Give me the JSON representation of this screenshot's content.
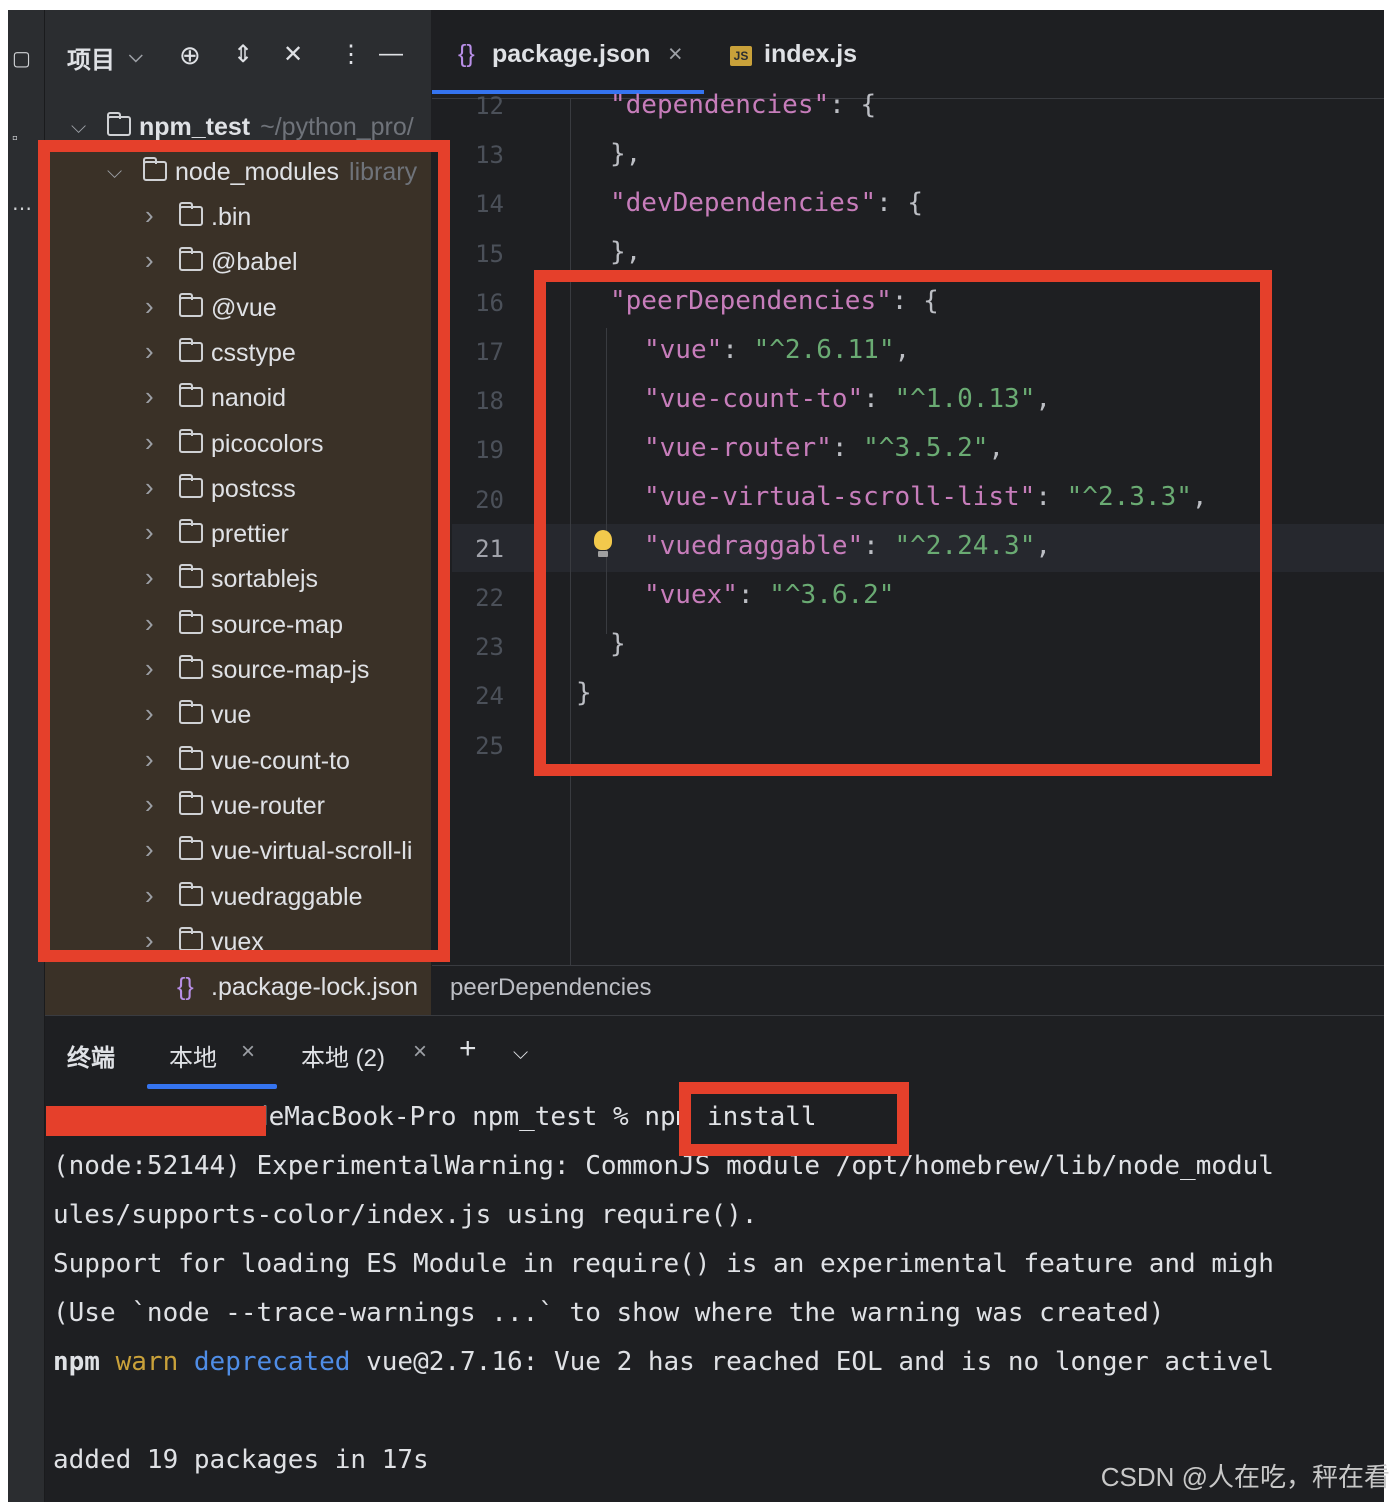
{
  "project_panel": {
    "title": "项目",
    "root": {
      "name": "npm_test",
      "hint": "~/python_pro/"
    },
    "node_modules": {
      "name": "node_modules",
      "hint": "library"
    },
    "folders": [
      ".bin",
      "@babel",
      "@vue",
      "csstype",
      "nanoid",
      "picocolors",
      "postcss",
      "prettier",
      "sortablejs",
      "source-map",
      "source-map-js",
      "vue",
      "vue-count-to",
      "vue-router",
      "vue-virtual-scroll-li",
      "vuedraggable",
      "vuex"
    ],
    "lock_file": ".package-lock.json"
  },
  "editor": {
    "tabs": [
      {
        "label": "package.json",
        "close": "×"
      },
      {
        "label": "index.js",
        "badge": "JS"
      }
    ],
    "line_numbers": [
      "12",
      "13",
      "14",
      "15",
      "16",
      "17",
      "18",
      "19",
      "20",
      "21",
      "22",
      "23",
      "24",
      "25"
    ],
    "current_line": "21",
    "code": {
      "l12_key": "\"dependencies\"",
      "l12_rest": ": {",
      "l13": "},",
      "l14_key": "\"devDependencies\"",
      "l14_rest": ": {",
      "l15": "},",
      "l16_key": "\"peerDependencies\"",
      "l16_rest": ": {",
      "l17_key": "\"vue\"",
      "l17_val": "\"^2.6.11\"",
      "l18_key": "\"vue-count-to\"",
      "l18_val": "\"^1.0.13\"",
      "l19_key": "\"vue-router\"",
      "l19_val": "\"^3.5.2\"",
      "l20_key": "\"vue-virtual-scroll-list\"",
      "l20_val": "\"^2.3.3\"",
      "l21_key": "\"vuedraggable\"",
      "l21_val": "\"^2.24.3\"",
      "l22_key": "\"vuex\"",
      "l22_val": "\"^3.6.2\"",
      "l23": "}",
      "l24": "}",
      "sep": ": ",
      "comma": ","
    },
    "breadcrumb": "peerDependencies"
  },
  "terminal": {
    "title": "终端",
    "tabs": [
      "本地",
      "本地 (2)"
    ],
    "lines": {
      "prompt_host": "deMacBook-Pro npm_test % ",
      "prompt_cmd": "npm install",
      "l2": "(node:52144) ExperimentalWarning: CommonJS module /opt/homebrew/lib/node_modul",
      "l3": "ules/supports-color/index.js using require().",
      "l4": "Support for loading ES Module in require() is an experimental feature and migh",
      "l5": "(Use `node --trace-warnings ...` to show where the warning was created)",
      "l6_npm": "npm",
      "l6_warn": "warn",
      "l6_dep": "deprecated",
      "l6_rest": "vue@2.7.16: Vue 2 has reached EOL and is no longer activel",
      "l8": "added 19 packages in 17s"
    }
  },
  "watermark": "CSDN @人在吃，秤在看",
  "colors": {
    "accent": "#3574f0",
    "highlight_box": "#e5402b",
    "string": "#6aab73",
    "key": "#c77dbb"
  }
}
